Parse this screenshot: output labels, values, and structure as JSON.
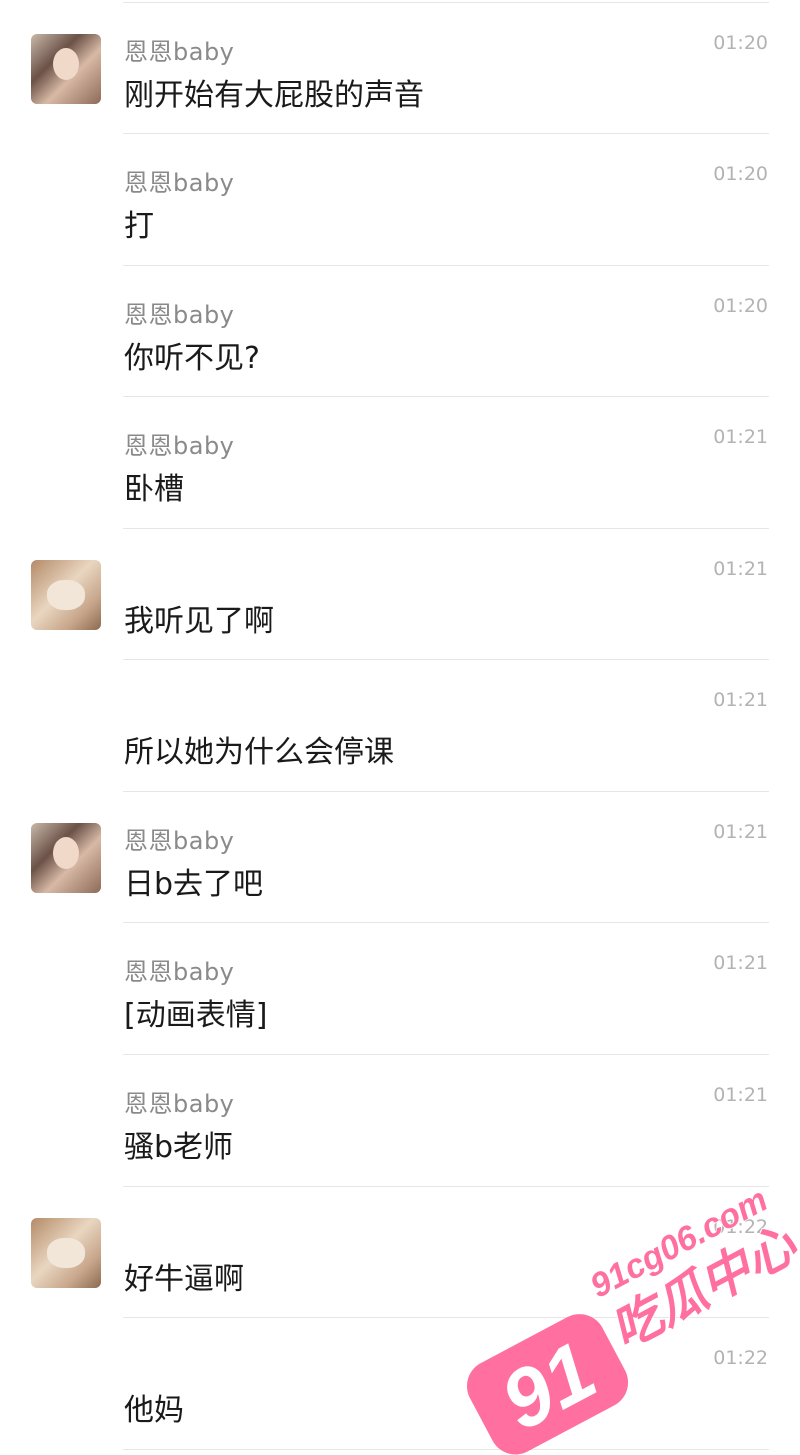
{
  "messages": [
    {
      "avatar": "girl",
      "sender": "恩恩baby",
      "time": "01:20",
      "text": "刚开始有大屁股的声音"
    },
    {
      "avatar": "",
      "sender": "恩恩baby",
      "time": "01:20",
      "text": "打"
    },
    {
      "avatar": "",
      "sender": "恩恩baby",
      "time": "01:20",
      "text": "你听不见?"
    },
    {
      "avatar": "",
      "sender": "恩恩baby",
      "time": "01:21",
      "text": "卧槽"
    },
    {
      "avatar": "cat",
      "sender": "",
      "time": "01:21",
      "text": "我听见了啊"
    },
    {
      "avatar": "",
      "sender": "",
      "time": "01:21",
      "text": "所以她为什么会停课"
    },
    {
      "avatar": "girl",
      "sender": "恩恩baby",
      "time": "01:21",
      "text": "日b去了吧"
    },
    {
      "avatar": "",
      "sender": "恩恩baby",
      "time": "01:21",
      "text": "[动画表情]"
    },
    {
      "avatar": "",
      "sender": "恩恩baby",
      "time": "01:21",
      "text": "骚b老师"
    },
    {
      "avatar": "cat",
      "sender": "",
      "time": "01:22",
      "text": "好牛逼啊"
    },
    {
      "avatar": "",
      "sender": "",
      "time": "01:22",
      "text": "他妈"
    }
  ],
  "watermark": {
    "number": "91",
    "domain": "91cg06.com",
    "name": "吃瓜中心",
    "color": "#ff6fa0"
  }
}
